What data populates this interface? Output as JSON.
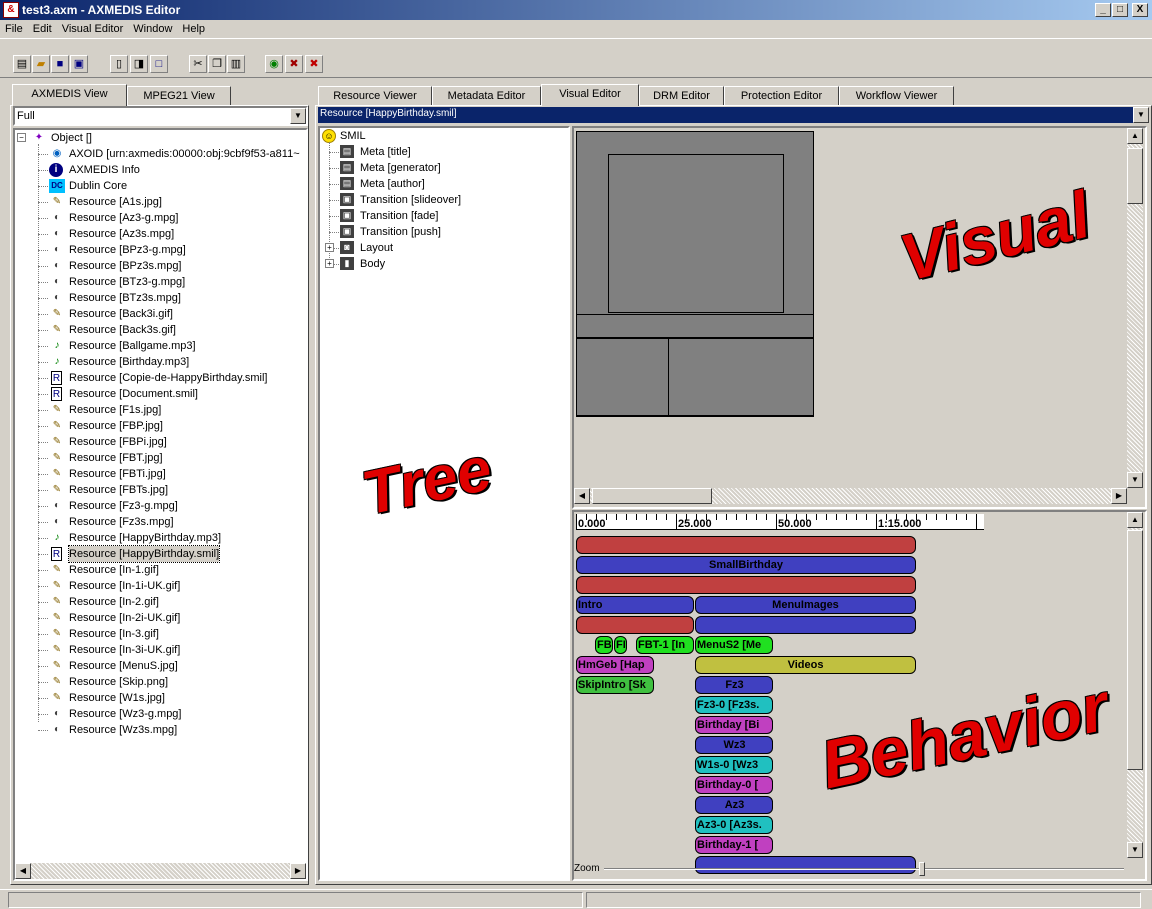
{
  "window": {
    "title": "test3.axm - AXMEDIS Editor",
    "minimize": "_",
    "maximize": "□",
    "close": "X",
    "app_icon": "axmedis-icon"
  },
  "menu": [
    "File",
    "Edit",
    "Visual Editor",
    "Window",
    "Help"
  ],
  "toolbar": {
    "icons": [
      "new-icon",
      "open-icon",
      "save-icon",
      "save-all-icon",
      "properties-icon",
      "import-icon",
      "window-icon",
      "cut-icon",
      "copy-icon",
      "paste-icon",
      "globe-icon",
      "tools-icon",
      "tools2-icon"
    ]
  },
  "left_panel": {
    "tabs": [
      "AXMEDIS View",
      "MPEG21 View"
    ],
    "dropdown_value": "Full",
    "root": "Object []",
    "items": [
      {
        "label": "AXOID [urn:axmedis:00000:obj:9cbf9f53-a811~",
        "icon": "globe-icon"
      },
      {
        "label": "AXMEDIS Info",
        "icon": "info-icon"
      },
      {
        "label": "Dublin Core",
        "icon": "dc-icon"
      },
      {
        "label": "Resource [A1s.jpg]",
        "icon": "image-icon"
      },
      {
        "label": "Resource [Az3-g.mpg]",
        "icon": "video-icon"
      },
      {
        "label": "Resource [Az3s.mpg]",
        "icon": "video-icon"
      },
      {
        "label": "Resource [BPz3-g.mpg]",
        "icon": "video-icon"
      },
      {
        "label": "Resource [BPz3s.mpg]",
        "icon": "video-icon"
      },
      {
        "label": "Resource [BTz3-g.mpg]",
        "icon": "video-icon"
      },
      {
        "label": "Resource [BTz3s.mpg]",
        "icon": "video-icon"
      },
      {
        "label": "Resource [Back3i.gif]",
        "icon": "image-icon"
      },
      {
        "label": "Resource [Back3s.gif]",
        "icon": "image-icon"
      },
      {
        "label": "Resource [Ballgame.mp3]",
        "icon": "audio-icon"
      },
      {
        "label": "Resource [Birthday.mp3]",
        "icon": "audio-icon"
      },
      {
        "label": "Resource [Copie-de-HappyBirthday.smil]",
        "icon": "smil-icon"
      },
      {
        "label": "Resource [Document.smil]",
        "icon": "smil-icon"
      },
      {
        "label": "Resource [F1s.jpg]",
        "icon": "image-icon"
      },
      {
        "label": "Resource [FBP.jpg]",
        "icon": "image-icon"
      },
      {
        "label": "Resource [FBPi.jpg]",
        "icon": "image-icon"
      },
      {
        "label": "Resource [FBT.jpg]",
        "icon": "image-icon"
      },
      {
        "label": "Resource [FBTi.jpg]",
        "icon": "image-icon"
      },
      {
        "label": "Resource [FBTs.jpg]",
        "icon": "image-icon"
      },
      {
        "label": "Resource [Fz3-g.mpg]",
        "icon": "video-icon"
      },
      {
        "label": "Resource [Fz3s.mpg]",
        "icon": "video-icon"
      },
      {
        "label": "Resource [HappyBirthday.mp3]",
        "icon": "audio-icon"
      },
      {
        "label": "Resource [HappyBirthday.smil]",
        "icon": "smil-icon",
        "selected": true
      },
      {
        "label": "Resource [In-1.gif]",
        "icon": "image-icon"
      },
      {
        "label": "Resource [In-1i-UK.gif]",
        "icon": "image-icon"
      },
      {
        "label": "Resource [In-2.gif]",
        "icon": "image-icon"
      },
      {
        "label": "Resource [In-2i-UK.gif]",
        "icon": "image-icon"
      },
      {
        "label": "Resource [In-3.gif]",
        "icon": "image-icon"
      },
      {
        "label": "Resource [In-3i-UK.gif]",
        "icon": "image-icon"
      },
      {
        "label": "Resource [MenuS.jpg]",
        "icon": "image-icon"
      },
      {
        "label": "Resource [Skip.png]",
        "icon": "image-icon"
      },
      {
        "label": "Resource [W1s.jpg]",
        "icon": "image-icon"
      },
      {
        "label": "Resource [Wz3-g.mpg]",
        "icon": "video-icon"
      },
      {
        "label": "Resource [Wz3s.mpg]",
        "icon": "video-icon"
      }
    ]
  },
  "right_panel": {
    "tabs": [
      "Resource Viewer",
      "Metadata Editor",
      "Visual Editor",
      "DRM Editor",
      "Protection Editor",
      "Workflow Viewer"
    ],
    "active_tab": "Visual Editor",
    "resource_dropdown": "Resource [HappyBirthday.smil]",
    "smil_tree": {
      "root": "SMIL",
      "items": [
        "Meta [title]",
        "Meta [generator]",
        "Meta [author]",
        "Transition [slideover]",
        "Transition [fade]",
        "Transition [push]",
        "Layout",
        "Body"
      ]
    },
    "overlay_labels": {
      "tree": "Tree",
      "visual": "Visual",
      "behavior": "Behavior"
    },
    "timeline": {
      "ruler": [
        "0.000",
        "25.000",
        "50.000",
        "1:15.000"
      ],
      "zoom_label": "Zoom",
      "colors": {
        "red": "#c04040",
        "blue": "#4040c0",
        "green": "#20e020",
        "magenta": "#c040c0",
        "olive": "#c0c040",
        "teal": "#20c0c0",
        "green2": "#40c040"
      },
      "bars": [
        {
          "label": "",
          "color": "red"
        },
        {
          "label": "SmallBirthday",
          "color": "blue"
        },
        {
          "label": "",
          "color": "red"
        },
        {
          "label": "Intro",
          "color": "blue"
        },
        {
          "label": "MenuImages",
          "color": "blue"
        },
        {
          "label": "",
          "color": "red"
        },
        {
          "label": "",
          "color": "blue"
        },
        {
          "label": "FB",
          "color": "green"
        },
        {
          "label": "FI",
          "color": "green"
        },
        {
          "label": "FBT-1 [In",
          "color": "green"
        },
        {
          "label": "MenuS2 [Me",
          "color": "green"
        },
        {
          "label": "HmGeb [Hap",
          "color": "magenta"
        },
        {
          "label": "Videos",
          "color": "olive"
        },
        {
          "label": "SkipIntro [Sk",
          "color": "green2"
        },
        {
          "label": "Fz3",
          "color": "blue"
        },
        {
          "label": "Fz3-0 [Fz3s.",
          "color": "teal"
        },
        {
          "label": "Birthday [Bi",
          "color": "magenta"
        },
        {
          "label": "Wz3",
          "color": "blue"
        },
        {
          "label": "W1s-0 [Wz3",
          "color": "teal"
        },
        {
          "label": "Birthday-0 [",
          "color": "magenta"
        },
        {
          "label": "Az3",
          "color": "blue"
        },
        {
          "label": "Az3-0 [Az3s.",
          "color": "teal"
        },
        {
          "label": "Birthday-1 [",
          "color": "magenta"
        },
        {
          "label": "",
          "color": "blue"
        }
      ]
    }
  }
}
